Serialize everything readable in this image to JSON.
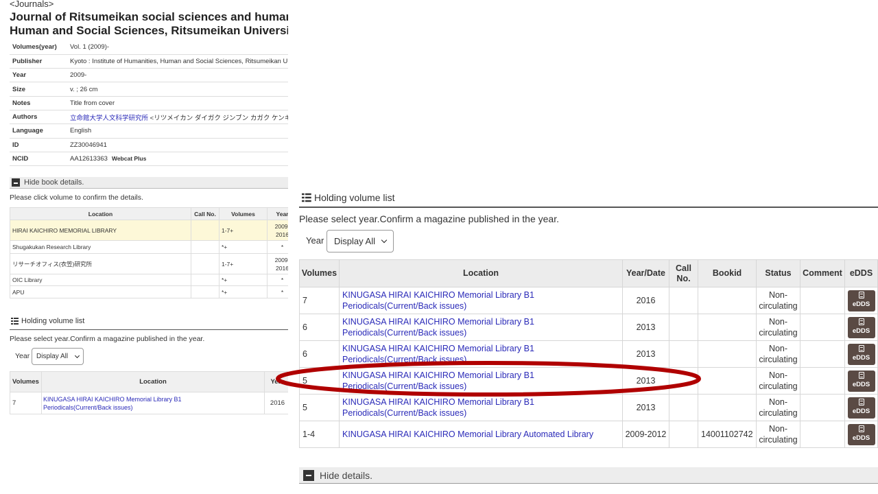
{
  "breadcrumb": "<Journals>",
  "journal_title": "Journal of Ritsumeikan social sciences and humanities / Institute of Humanities, Human and Social Sciences, Ritsumeikan University",
  "details": [
    {
      "key": "Volumes(year)",
      "value": "Vol. 1 (2009)-"
    },
    {
      "key": "Publisher",
      "value": "Kyoto : Institute of Humanities, Human and Social Sciences, Ritsumeikan University"
    },
    {
      "key": "Year",
      "value": "2009-"
    },
    {
      "key": "Size",
      "value": "v. ; 26 cm"
    },
    {
      "key": "Notes",
      "value": "Title from cover"
    },
    {
      "key": "Authors",
      "link": "立命館大学人文科学研究所",
      "value": "<リツメイカン ダイガク ジンブン カガク ケンキュウジョ>"
    },
    {
      "key": "Language",
      "value": "English"
    },
    {
      "key": "ID",
      "value": "ZZ30046941"
    },
    {
      "key": "NCID",
      "value": "AA12613363",
      "extra": "Webcat Plus"
    }
  ],
  "hide_book_details": "Hide book details.",
  "click_note": "Please click volume to confirm the details.",
  "locations_table": {
    "headers": [
      "Location",
      "Call No.",
      "Volumes",
      "Year"
    ],
    "rows": [
      {
        "location": "HIRAI KAICHIRO MEMORIAL LIBRARY",
        "callno": "",
        "volumes": "1-7+",
        "year1": "2009-",
        "year2": "2016"
      },
      {
        "location": "Shugakukan Research Library",
        "callno": "",
        "volumes": "*+",
        "year1": "*",
        "year2": ""
      },
      {
        "location": "リサーチオフィス(衣笠)研究所",
        "callno": "",
        "volumes": "1-7+",
        "year1": "2009-",
        "year2": "2016"
      },
      {
        "location": "OIC Library",
        "callno": "",
        "volumes": "*+",
        "year1": "*",
        "year2": ""
      },
      {
        "location": "APU",
        "callno": "",
        "volumes": "*+",
        "year1": "*",
        "year2": ""
      }
    ]
  },
  "holding_title": "Holding volume list",
  "select_note": "Please select year.Confirm a magazine published in the year.",
  "year_label": "Year",
  "year_select_value": "Display All",
  "bg_volume_table": {
    "headers": [
      "Volumes",
      "Location",
      "Year"
    ],
    "row": {
      "volumes": "7",
      "loc1": "KINUGASA HIRAI KAICHIRO Memorial Library B1",
      "loc2": "Periodicals(Current/Back issues)",
      "year": "2016"
    }
  },
  "volume_table": {
    "headers": {
      "volumes": "Volumes",
      "location": "Location",
      "year": "Year/Date",
      "callno1": "Call",
      "callno2": "No.",
      "bookid": "Bookid",
      "status": "Status",
      "comment": "Comment",
      "edds": "eDDS"
    },
    "rows": [
      {
        "volumes": "7",
        "loc1": "KINUGASA HIRAI KAICHIRO Memorial Library B1",
        "loc2": "Periodicals(Current/Back issues)",
        "year": "2016",
        "callno": "",
        "bookid": "",
        "status1": "Non-",
        "status2": "circulating",
        "comment": "",
        "edds": "eDDS"
      },
      {
        "volumes": "6",
        "loc1": "KINUGASA HIRAI KAICHIRO Memorial Library B1",
        "loc2": "Periodicals(Current/Back issues)",
        "year": "2013",
        "callno": "",
        "bookid": "",
        "status1": "Non-",
        "status2": "circulating",
        "comment": "",
        "edds": "eDDS"
      },
      {
        "volumes": "6",
        "loc1": "KINUGASA HIRAI KAICHIRO Memorial Library B1",
        "loc2": "Periodicals(Current/Back issues)",
        "year": "2013",
        "callno": "",
        "bookid": "",
        "status1": "Non-",
        "status2": "circulating",
        "comment": "",
        "edds": "eDDS"
      },
      {
        "volumes": "5",
        "loc1": "KINUGASA HIRAI KAICHIRO Memorial Library B1",
        "loc2": "Periodicals(Current/Back issues)",
        "year": "2013",
        "callno": "",
        "bookid": "",
        "status1": "Non-",
        "status2": "circulating",
        "comment": "",
        "edds": "eDDS"
      },
      {
        "volumes": "5",
        "loc1": "KINUGASA HIRAI KAICHIRO Memorial Library B1",
        "loc2": "Periodicals(Current/Back issues)",
        "year": "2013",
        "callno": "",
        "bookid": "",
        "status1": "Non-",
        "status2": "circulating",
        "comment": "",
        "edds": "eDDS"
      },
      {
        "volumes": "1-4",
        "loc1": "KINUGASA HIRAI KAICHIRO Memorial Library Automated Library",
        "loc2": "",
        "year": "2009-2012",
        "callno": "",
        "bookid": "14001102742",
        "status1": "Non-",
        "status2": "circulating",
        "comment": "",
        "edds": "eDDS"
      }
    ]
  },
  "hide_details": "Hide details.",
  "colors": {
    "link": "#2a2ab8",
    "edds_button": "#5a4a44",
    "highlight_ellipse": "#b00000",
    "highlight_row": "#fdf8d8"
  }
}
